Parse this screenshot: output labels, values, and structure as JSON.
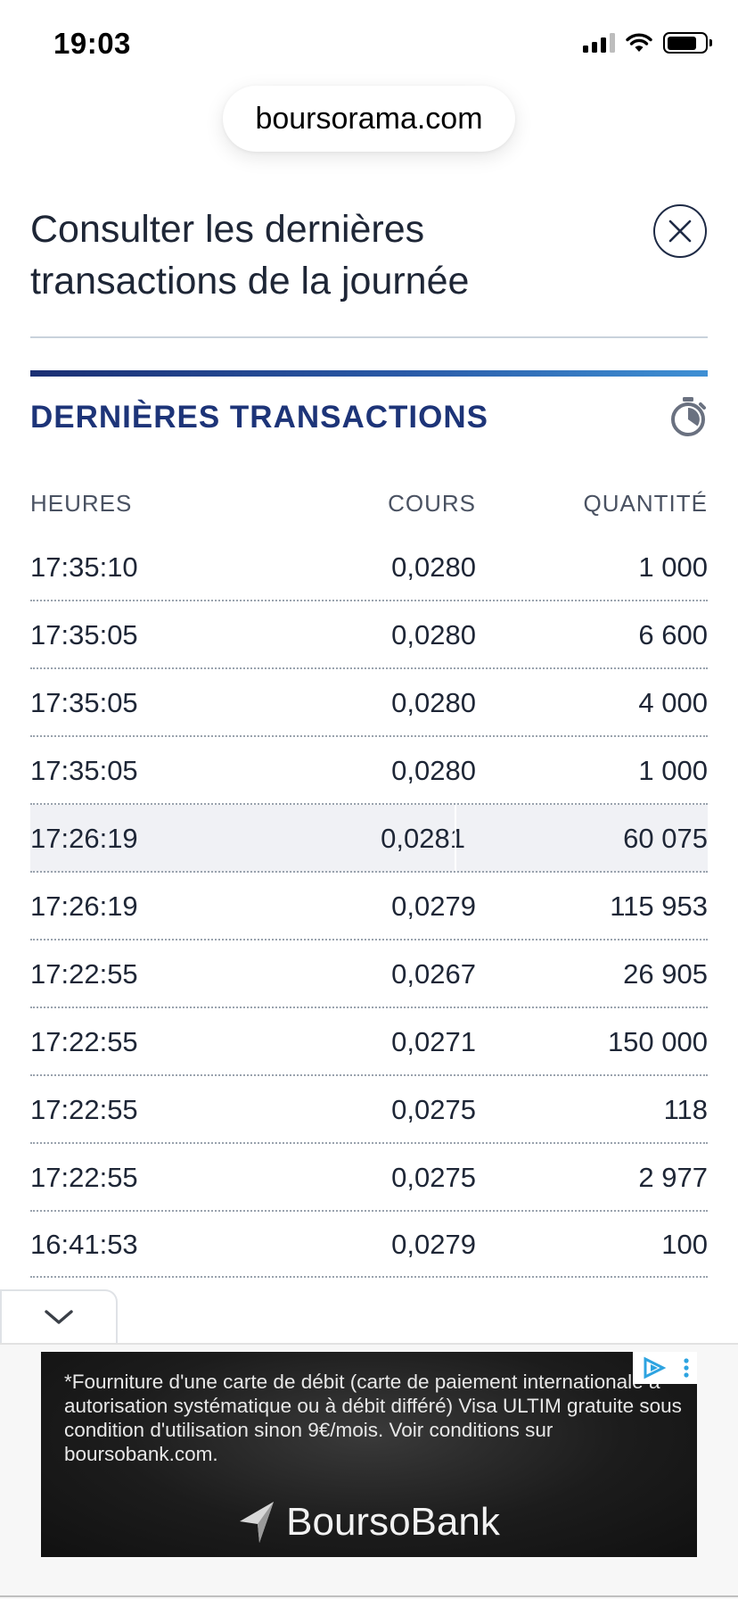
{
  "status_bar": {
    "time": "19:03"
  },
  "browser": {
    "url": "boursorama.com"
  },
  "modal": {
    "title": "Consulter les dernières transactions de la journée"
  },
  "section": {
    "title": "DERNIÈRES TRANSACTIONS"
  },
  "table": {
    "headers": {
      "time": "HEURES",
      "price": "COURS",
      "qty": "QUANTITÉ"
    },
    "rows": [
      {
        "time": "17:35:10",
        "price": "0,0280",
        "qty": "1 000"
      },
      {
        "time": "17:35:05",
        "price": "0,0280",
        "qty": "6 600"
      },
      {
        "time": "17:35:05",
        "price": "0,0280",
        "qty": "4 000"
      },
      {
        "time": "17:35:05",
        "price": "0,0280",
        "qty": "1 000"
      },
      {
        "time": "17:26:19",
        "price": "0,0281",
        "qty": "60 075"
      },
      {
        "time": "17:26:19",
        "price": "0,0279",
        "qty": "115 953"
      },
      {
        "time": "17:22:55",
        "price": "0,0267",
        "qty": "26 905"
      },
      {
        "time": "17:22:55",
        "price": "0,0271",
        "qty": "150 000"
      },
      {
        "time": "17:22:55",
        "price": "0,0275",
        "qty": "118"
      },
      {
        "time": "17:22:55",
        "price": "0,0275",
        "qty": "2 977"
      },
      {
        "time": "16:41:53",
        "price": "0,0279",
        "qty": "100"
      }
    ]
  },
  "ad": {
    "text": "*Fourniture d'une carte de débit (carte de paiement internationale à autorisation systématique ou à débit différé) Visa ULTIM gratuite sous condition d'utilisation sinon 9€/mois. Voir conditions sur boursobank.com.",
    "brand": "BoursoBank"
  },
  "colors": {
    "accent_navy": "#1d3478",
    "title_text": "#1e2636",
    "highlight_row": "#f0f1f5"
  },
  "icons": [
    "close-icon",
    "stopwatch-icon",
    "chevron-down-icon",
    "adchoices-icon",
    "ad-menu-icon",
    "boursobank-logo-icon"
  ]
}
